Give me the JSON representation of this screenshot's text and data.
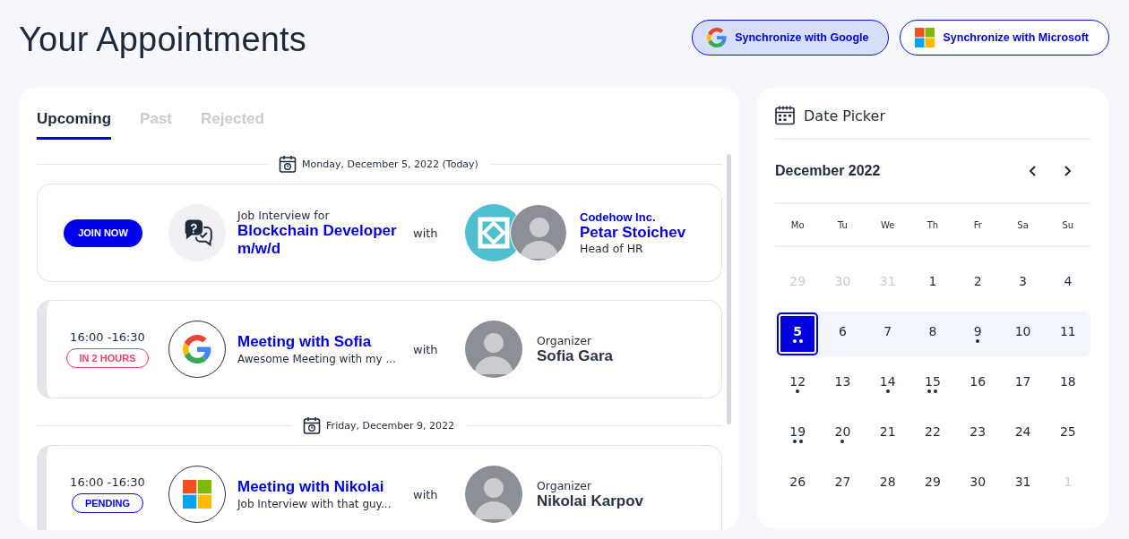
{
  "page": {
    "title": "Your Appointments"
  },
  "sync_buttons": [
    {
      "label": "Synchronize with Google",
      "kind": "google",
      "highlighted": true
    },
    {
      "label": "Synchronize with Microsoft",
      "kind": "microsoft",
      "highlighted": false
    }
  ],
  "tabs": [
    {
      "label": "Upcoming",
      "selected": true
    },
    {
      "label": "Past",
      "selected": false
    },
    {
      "label": "Rejected",
      "selected": false
    }
  ],
  "groups": [
    {
      "date": "Monday, December 5, 2022 (Today)",
      "appointments": [
        {
          "kind": "live",
          "action": "JOIN NOW",
          "logo": {
            "kind": "chat"
          },
          "subtitle": "Job Interview for",
          "title": "Blockchain Developer m/w/d",
          "with": "with",
          "company_logo": true,
          "company": "Codehow Inc.",
          "person": "Petar Stoichev",
          "role": "Head of HR"
        },
        {
          "kind": "scheduled",
          "time": "16:00 -16:30",
          "status": {
            "label": "IN 2 HOURS",
            "kind": "soon"
          },
          "logo": {
            "kind": "google"
          },
          "title": "Meeting with Sofia",
          "description": "Awesome Meeting with my ...",
          "with": "with",
          "company_logo": false,
          "role": "Organizer",
          "person": "Sofia Gara"
        }
      ]
    },
    {
      "date": "Friday, December 9, 2022",
      "appointments": [
        {
          "kind": "scheduled",
          "time": "16:00 -16:30",
          "status": {
            "label": "PENDING",
            "kind": "pending"
          },
          "logo": {
            "kind": "microsoft"
          },
          "title": "Meeting with Nikolai",
          "description": "Job Interview with that guy...",
          "with": "with",
          "company_logo": false,
          "role": "Organizer",
          "person": "Nikolai Karpov"
        }
      ]
    }
  ],
  "date_picker": {
    "title": "Date Picker",
    "month": "December 2022",
    "weekdays": [
      "Mo",
      "Tu",
      "We",
      "Th",
      "Fr",
      "Sa",
      "Su"
    ],
    "weeks": [
      {
        "current": false,
        "days": [
          {
            "label": "29",
            "muted": true,
            "selected": false
          },
          {
            "label": "30",
            "muted": true,
            "selected": false
          },
          {
            "label": "31",
            "muted": true,
            "selected": false
          },
          {
            "label": "1",
            "muted": false,
            "selected": false
          },
          {
            "label": "2",
            "muted": false,
            "selected": false
          },
          {
            "label": "3",
            "muted": false,
            "selected": false
          },
          {
            "label": "4",
            "muted": false,
            "selected": false
          }
        ]
      },
      {
        "current": true,
        "days": [
          {
            "label": "5",
            "muted": false,
            "selected": true,
            "events": [
              {
                "kind": "dot"
              },
              {
                "kind": "dot"
              }
            ]
          },
          {
            "label": "6",
            "muted": false,
            "selected": false
          },
          {
            "label": "7",
            "muted": false,
            "selected": false
          },
          {
            "label": "8",
            "muted": false,
            "selected": false
          },
          {
            "label": "9",
            "muted": false,
            "selected": false,
            "events": [
              {
                "kind": "dot"
              }
            ]
          },
          {
            "label": "10",
            "muted": false,
            "selected": false
          },
          {
            "label": "11",
            "muted": false,
            "selected": false
          }
        ]
      },
      {
        "current": false,
        "days": [
          {
            "label": "12",
            "muted": false,
            "selected": false,
            "events": [
              {
                "kind": "dot"
              }
            ]
          },
          {
            "label": "13",
            "muted": false,
            "selected": false
          },
          {
            "label": "14",
            "muted": false,
            "selected": false,
            "events": [
              {
                "kind": "dot"
              }
            ]
          },
          {
            "label": "15",
            "muted": false,
            "selected": false,
            "events": [
              {
                "kind": "dot"
              },
              {
                "kind": "dot"
              }
            ]
          },
          {
            "label": "16",
            "muted": false,
            "selected": false
          },
          {
            "label": "17",
            "muted": false,
            "selected": false
          },
          {
            "label": "18",
            "muted": false,
            "selected": false
          }
        ]
      },
      {
        "current": false,
        "days": [
          {
            "label": "19",
            "muted": false,
            "selected": false,
            "events": [
              {
                "kind": "dot"
              },
              {
                "kind": "dot"
              }
            ]
          },
          {
            "label": "20",
            "muted": false,
            "selected": false,
            "events": [
              {
                "kind": "dot"
              }
            ]
          },
          {
            "label": "21",
            "muted": false,
            "selected": false
          },
          {
            "label": "22",
            "muted": false,
            "selected": false
          },
          {
            "label": "23",
            "muted": false,
            "selected": false
          },
          {
            "label": "24",
            "muted": false,
            "selected": false
          },
          {
            "label": "25",
            "muted": false,
            "selected": false
          }
        ]
      },
      {
        "current": false,
        "days": [
          {
            "label": "26",
            "muted": false,
            "selected": false
          },
          {
            "label": "27",
            "muted": false,
            "selected": false
          },
          {
            "label": "28",
            "muted": false,
            "selected": false
          },
          {
            "label": "29",
            "muted": false,
            "selected": false
          },
          {
            "label": "30",
            "muted": false,
            "selected": false
          },
          {
            "label": "31",
            "muted": false,
            "selected": false
          },
          {
            "label": "1",
            "muted": true,
            "selected": false
          }
        ]
      }
    ]
  }
}
